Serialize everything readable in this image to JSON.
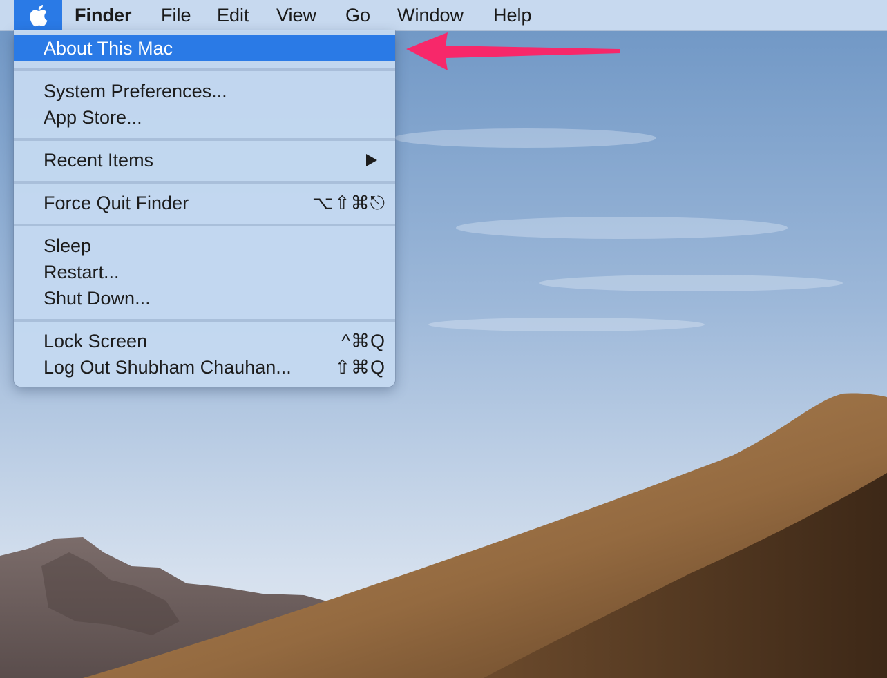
{
  "menubar": {
    "apple_icon": "apple-icon",
    "app_name": "Finder",
    "menus": [
      "File",
      "Edit",
      "View",
      "Go",
      "Window",
      "Help"
    ]
  },
  "apple_menu": {
    "about": "About This Mac",
    "system_prefs": "System Preferences...",
    "app_store": "App Store...",
    "recent_items": "Recent Items",
    "force_quit": "Force Quit Finder",
    "force_quit_shortcut": "⌥⇧⌘⎋",
    "sleep": "Sleep",
    "restart": "Restart...",
    "shut_down": "Shut Down...",
    "lock_screen": "Lock Screen",
    "lock_screen_shortcut": "^⌘Q",
    "log_out": "Log Out Shubham Chauhan...",
    "log_out_shortcut": "⇧⌘Q"
  },
  "colors": {
    "highlight": "#2a7ae6",
    "annotation_arrow": "#f7286a"
  }
}
